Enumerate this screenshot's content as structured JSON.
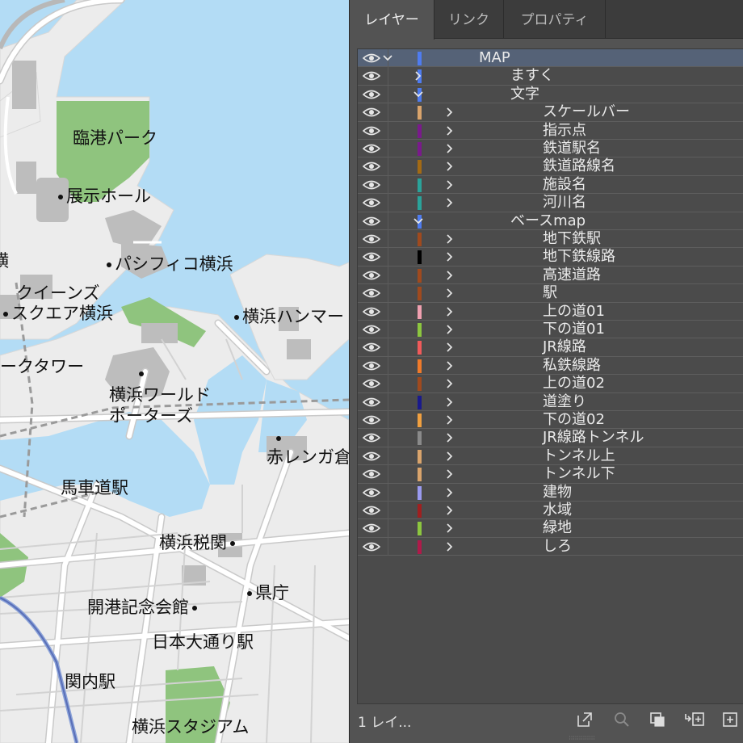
{
  "panel": {
    "tabs": [
      {
        "label": "レイヤー",
        "active": true
      },
      {
        "label": "リンク",
        "active": false
      },
      {
        "label": "プロパティ",
        "active": false
      }
    ],
    "layers": [
      {
        "name": "MAP",
        "level": 0,
        "expanded": true,
        "color": "#4f7cf0",
        "selected": true
      },
      {
        "name": "ますく",
        "level": 1,
        "expanded": false,
        "color": "#4f7cf0"
      },
      {
        "name": "文字",
        "level": 1,
        "expanded": true,
        "color": "#4f7cf0"
      },
      {
        "name": "スケールバー",
        "level": 2,
        "expanded": false,
        "color": "#d9a46c"
      },
      {
        "name": "指示点",
        "level": 2,
        "expanded": false,
        "color": "#7a1a8c"
      },
      {
        "name": "鉄道駅名",
        "level": 2,
        "expanded": false,
        "color": "#7a1a8c"
      },
      {
        "name": "鉄道路線名",
        "level": 2,
        "expanded": false,
        "color": "#a36a14"
      },
      {
        "name": "施設名",
        "level": 2,
        "expanded": false,
        "color": "#2aa39a"
      },
      {
        "name": "河川名",
        "level": 2,
        "expanded": false,
        "color": "#2aa39a"
      },
      {
        "name": "ベースmap",
        "level": 1,
        "expanded": true,
        "color": "#4f7cf0"
      },
      {
        "name": "地下鉄駅",
        "level": 2,
        "expanded": false,
        "color": "#a04a1e"
      },
      {
        "name": "地下鉄線路",
        "level": 2,
        "expanded": false,
        "color": "#000000"
      },
      {
        "name": "高速道路",
        "level": 2,
        "expanded": false,
        "color": "#a04a1e"
      },
      {
        "name": "駅",
        "level": 2,
        "expanded": false,
        "color": "#a04a1e"
      },
      {
        "name": "上の道01",
        "level": 2,
        "expanded": false,
        "color": "#f0a0b0"
      },
      {
        "name": "下の道01",
        "level": 2,
        "expanded": false,
        "color": "#8cc63f"
      },
      {
        "name": "JR線路",
        "level": 2,
        "expanded": false,
        "color": "#f05a5a"
      },
      {
        "name": "私鉄線路",
        "level": 2,
        "expanded": false,
        "color": "#f07a2a"
      },
      {
        "name": "上の道02",
        "level": 2,
        "expanded": false,
        "color": "#a04a1e"
      },
      {
        "name": "道塗り",
        "level": 2,
        "expanded": false,
        "color": "#1a1a8c"
      },
      {
        "name": "下の道02",
        "level": 2,
        "expanded": false,
        "color": "#f0a040"
      },
      {
        "name": "JR線路トンネル",
        "level": 2,
        "expanded": false,
        "color": "#8a8a8a"
      },
      {
        "name": "トンネル上",
        "level": 2,
        "expanded": false,
        "color": "#d9a46c"
      },
      {
        "name": "トンネル下",
        "level": 2,
        "expanded": false,
        "color": "#d9a46c"
      },
      {
        "name": "建物",
        "level": 2,
        "expanded": false,
        "color": "#9a9af0"
      },
      {
        "name": "水域",
        "level": 2,
        "expanded": false,
        "color": "#a02020"
      },
      {
        "name": "緑地",
        "level": 2,
        "expanded": false,
        "color": "#8cc63f"
      },
      {
        "name": "しろ",
        "level": 2,
        "expanded": false,
        "color": "#b01a4a"
      }
    ],
    "footer": {
      "count_label": "1 レイ..."
    }
  },
  "map": {
    "labels": [
      {
        "id": "rinko-park",
        "text": "臨港パーク",
        "dot": "none"
      },
      {
        "id": "tenji-hall",
        "text": "展示ホール",
        "dot": "before"
      },
      {
        "id": "pacifico",
        "text": "パシフィコ横浜",
        "dot": "before"
      },
      {
        "id": "queens",
        "text": "クイーンズ",
        "dot": "none"
      },
      {
        "id": "square",
        "text": "スクエア横浜",
        "dot": "before"
      },
      {
        "id": "hammer",
        "text": "横浜ハンマー",
        "dot": "before"
      },
      {
        "id": "landmark",
        "text": "ークタワー",
        "dot": "none"
      },
      {
        "id": "world-porters-1",
        "text": "横浜ワールド",
        "dot": "none"
      },
      {
        "id": "world-porters-2",
        "text": "ポーターズ",
        "dot": "none"
      },
      {
        "id": "akarenga",
        "text": "赤レンガ倉",
        "dot": "none"
      },
      {
        "id": "bashamichi",
        "text": "馬車道駅",
        "dot": "none"
      },
      {
        "id": "zeikan",
        "text": "横浜税関",
        "dot": "after"
      },
      {
        "id": "kencho",
        "text": "県庁",
        "dot": "before"
      },
      {
        "id": "kaiko",
        "text": "開港記念会館",
        "dot": "after"
      },
      {
        "id": "nihon-odori",
        "text": "日本大通り駅",
        "dot": "none"
      },
      {
        "id": "kannai",
        "text": "関内駅",
        "dot": "none"
      },
      {
        "id": "stadium",
        "text": "横浜スタジアム",
        "dot": "none"
      },
      {
        "id": "edge-fragment",
        "text": "横",
        "dot": "none"
      }
    ]
  },
  "colors": {
    "water": "#b3dcf5",
    "land": "#ececec",
    "park": "#8fc47e",
    "building": "#bdbdbd",
    "road": "#ffffff",
    "panel": "#535353",
    "selected": "#556277"
  },
  "icons": [
    "eye-icon",
    "chevron-right-icon",
    "chevron-down-icon",
    "export-icon",
    "search-icon",
    "clipping-mask-icon",
    "new-sublayer-icon",
    "new-layer-icon"
  ]
}
